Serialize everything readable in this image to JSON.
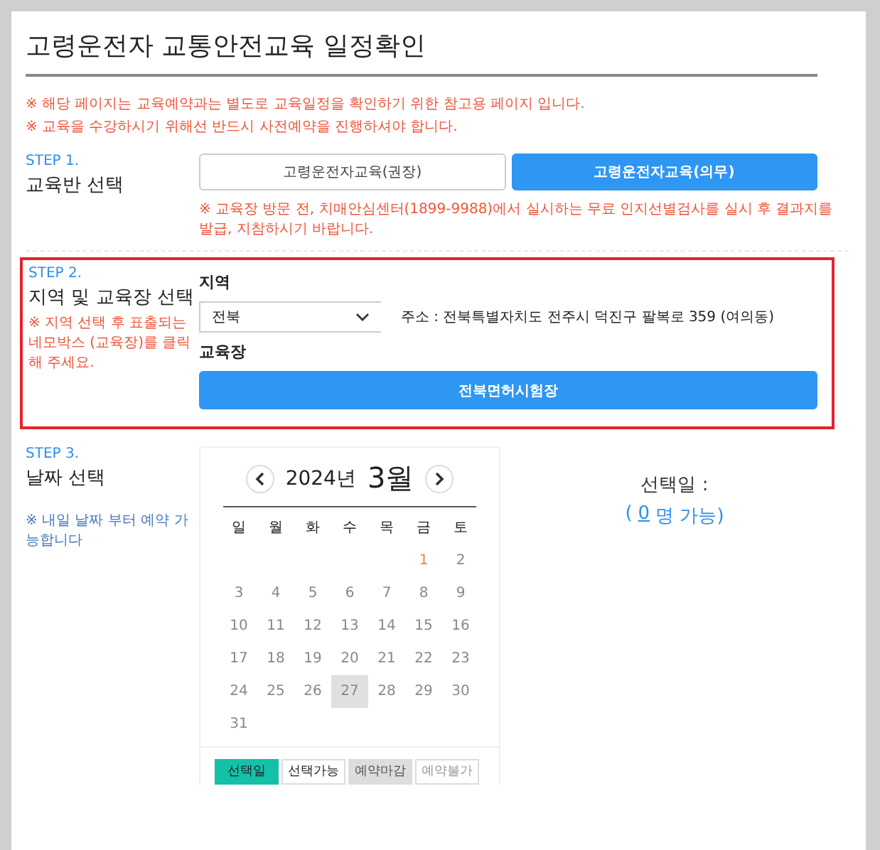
{
  "title": "고령운전자 교통안전교육 일정확인",
  "notices": [
    "※ 해당 페이지는 교육예약과는 별도로 교육일정을 확인하기 위한 참고용 페이지 입니다.",
    "※ 교육을 수강하시기 위해선 반드시 사전예약을 진행하셔야 합니다."
  ],
  "step1": {
    "step": "STEP 1.",
    "heading": "교육반 선택",
    "options": [
      {
        "label": "고령운전자교육(권장)",
        "selected": false
      },
      {
        "label": "고령운전자교육(의무)",
        "selected": true
      }
    ],
    "note": "※ 교육장 방문 전, 치매안심센터(1899-9988)에서 실시하는 무료 인지선별검사를 실시 후 결과지를 발급, 지참하시기 바랍니다."
  },
  "step2": {
    "step": "STEP 2.",
    "heading": "지역 및 교육장 선택",
    "note": "※ 지역 선택 후 표출되는 네모박스 (교육장)를 클릭해 주세요.",
    "region_label": "지역",
    "region_value": "전북",
    "address": "주소 : 전북특별자치도 전주시 덕진구 팔복로 359 (여의동)",
    "venue_label": "교육장",
    "venues": [
      "전북면허시험장"
    ]
  },
  "step3": {
    "step": "STEP 3.",
    "heading": "날짜 선택",
    "note": "※ 내일 날짜 부터 예약 가능합니다",
    "calendar": {
      "year": "2024년",
      "month": "3월",
      "weekdays": [
        "일",
        "월",
        "화",
        "수",
        "목",
        "금",
        "토"
      ],
      "days": [
        {
          "kind": "blank"
        },
        {
          "kind": "blank"
        },
        {
          "kind": "blank"
        },
        {
          "kind": "blank"
        },
        {
          "kind": "blank"
        },
        {
          "day": "1",
          "kind": "holiday"
        },
        {
          "day": "2",
          "kind": "normal"
        },
        {
          "day": "3",
          "kind": "normal"
        },
        {
          "day": "4",
          "kind": "normal"
        },
        {
          "day": "5",
          "kind": "normal"
        },
        {
          "day": "6",
          "kind": "normal"
        },
        {
          "day": "7",
          "kind": "normal"
        },
        {
          "day": "8",
          "kind": "normal"
        },
        {
          "day": "9",
          "kind": "normal"
        },
        {
          "day": "10",
          "kind": "normal"
        },
        {
          "day": "11",
          "kind": "normal"
        },
        {
          "day": "12",
          "kind": "normal"
        },
        {
          "day": "13",
          "kind": "normal"
        },
        {
          "day": "14",
          "kind": "normal"
        },
        {
          "day": "15",
          "kind": "normal"
        },
        {
          "day": "16",
          "kind": "normal"
        },
        {
          "day": "17",
          "kind": "normal"
        },
        {
          "day": "18",
          "kind": "normal"
        },
        {
          "day": "19",
          "kind": "normal"
        },
        {
          "day": "20",
          "kind": "normal"
        },
        {
          "day": "21",
          "kind": "normal"
        },
        {
          "day": "22",
          "kind": "normal"
        },
        {
          "day": "23",
          "kind": "normal"
        },
        {
          "day": "24",
          "kind": "normal"
        },
        {
          "day": "25",
          "kind": "normal"
        },
        {
          "day": "26",
          "kind": "normal"
        },
        {
          "day": "27",
          "kind": "closed"
        },
        {
          "day": "28",
          "kind": "normal"
        },
        {
          "day": "29",
          "kind": "normal"
        },
        {
          "day": "30",
          "kind": "normal"
        },
        {
          "day": "31",
          "kind": "normal"
        }
      ],
      "legend": [
        {
          "label": "선택일",
          "kind": "selected"
        },
        {
          "label": "선택가능",
          "kind": "available"
        },
        {
          "label": "예약마감",
          "kind": "closed"
        },
        {
          "label": "예약불가",
          "kind": "unavailable"
        }
      ]
    },
    "selected_label": "선택일 :",
    "capacity_open": "(",
    "capacity_count": "0",
    "capacity_text": "명 가능)"
  }
}
